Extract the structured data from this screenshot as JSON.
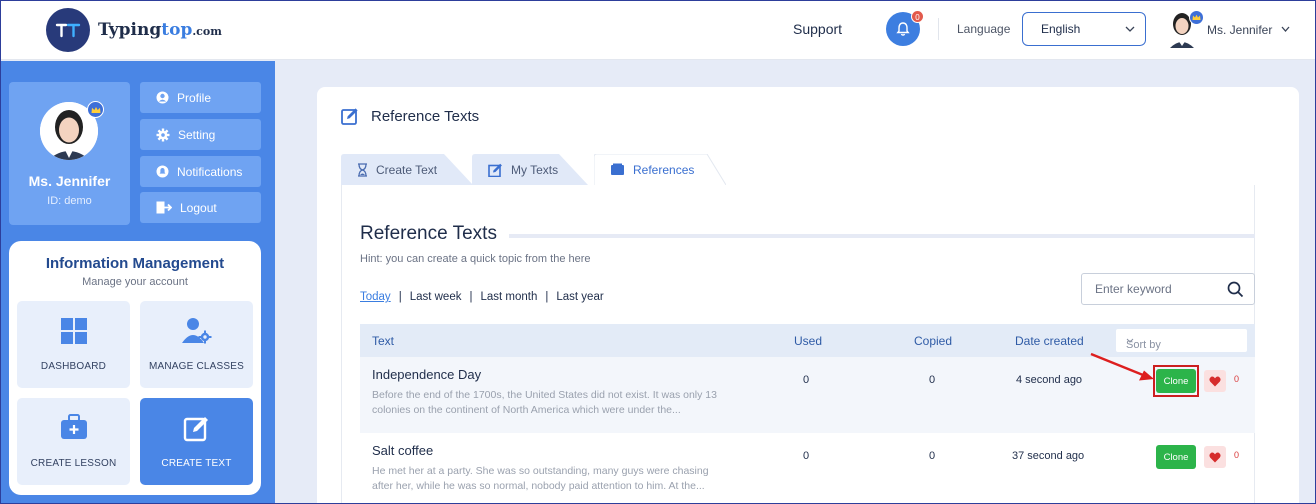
{
  "brand": {
    "name_part1": "Typing",
    "name_part2": "top",
    "domain": ".com"
  },
  "header": {
    "support": "Support",
    "notifications_count": "0",
    "language_label": "Language",
    "language_value": "English",
    "user_name": "Ms. Jennifer"
  },
  "sidebar": {
    "profile": {
      "name": "Ms. Jennifer",
      "id": "ID: demo"
    },
    "menu": [
      {
        "label": "Profile",
        "icon": "user-circle-icon"
      },
      {
        "label": "Setting",
        "icon": "gear-icon"
      },
      {
        "label": "Notifications",
        "icon": "bell-icon"
      },
      {
        "label": "Logout",
        "icon": "logout-icon"
      }
    ],
    "info": {
      "title": "Information Management",
      "subtitle": "Manage your account",
      "tiles": [
        {
          "label": "DASHBOARD",
          "icon": "grid-icon"
        },
        {
          "label": "MANAGE CLASSES",
          "icon": "user-gear-icon"
        },
        {
          "label": "CREATE LESSON",
          "icon": "briefcase-plus-icon"
        },
        {
          "label": "CREATE TEXT",
          "icon": "edit-icon"
        }
      ]
    }
  },
  "main": {
    "page_title": "Reference Texts",
    "tabs": [
      {
        "label": "Create Text",
        "icon": "hourglass-icon"
      },
      {
        "label": "My Texts",
        "icon": "edit-icon"
      },
      {
        "label": "References",
        "icon": "folder-icon",
        "active": true
      }
    ],
    "section_title": "Reference Texts",
    "hint": "Hint: you can create a quick topic from the here",
    "filters": [
      "Today",
      "Last week",
      "Last month",
      "Last year"
    ],
    "active_filter": "Today",
    "search_placeholder": "Enter keyword",
    "table": {
      "headers": {
        "text": "Text",
        "used": "Used",
        "copied": "Copied",
        "date": "Date created",
        "sort": "Sort by"
      },
      "rows": [
        {
          "title": "Independence Day",
          "desc": "Before the end of the 1700s, the United States did not exist. It was only 13 colonies on the continent of North America which were under the...",
          "used": "0",
          "copied": "0",
          "date": "4 second ago",
          "clone": "Clone",
          "favs": "0"
        },
        {
          "title": "Salt coffee",
          "desc": "He met her at a party. She was so outstanding, many guys were chasing after her, while he was so normal, nobody paid attention to him. At the...",
          "used": "0",
          "copied": "0",
          "date": "37 second ago",
          "clone": "Clone",
          "favs": "0"
        }
      ]
    }
  },
  "colors": {
    "sidebar": "#4a86e6",
    "accent": "#3a7de0",
    "clone": "#2cb44a",
    "highlight": "#cc1f1f"
  }
}
